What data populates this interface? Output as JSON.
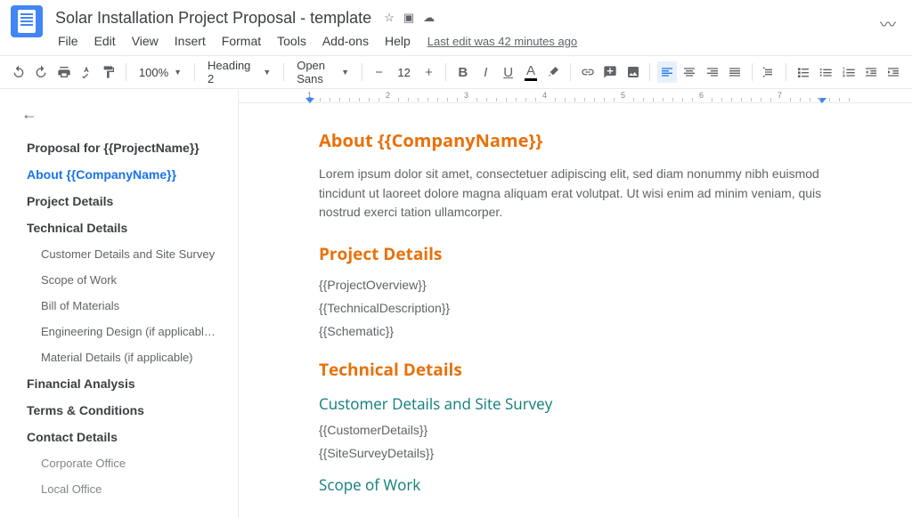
{
  "header": {
    "doc_title": "Solar Installation Project Proposal - template",
    "last_edit": "Last edit was 42 minutes ago"
  },
  "menu": {
    "file": "File",
    "edit": "Edit",
    "view": "View",
    "insert": "Insert",
    "format": "Format",
    "tools": "Tools",
    "addons": "Add-ons",
    "help": "Help"
  },
  "toolbar": {
    "zoom": "100%",
    "style": "Heading 2",
    "font": "Open Sans",
    "size": "12"
  },
  "outline": {
    "items": [
      {
        "label": "Proposal for {{ProjectName}}",
        "level": "h1"
      },
      {
        "label": "About {{CompanyName}}",
        "level": "h1",
        "active": true
      },
      {
        "label": "Project Details",
        "level": "h1"
      },
      {
        "label": "Technical Details",
        "level": "h1"
      },
      {
        "label": "Customer Details and Site Survey",
        "level": "h2"
      },
      {
        "label": "Scope of Work",
        "level": "h2"
      },
      {
        "label": "Bill of Materials",
        "level": "h2"
      },
      {
        "label": "Engineering Design (if applicabl…",
        "level": "h2"
      },
      {
        "label": "Material Details (if applicable)",
        "level": "h2"
      },
      {
        "label": "Financial Analysis",
        "level": "h1"
      },
      {
        "label": "Terms & Conditions",
        "level": "h1"
      },
      {
        "label": "Contact Details",
        "level": "h1"
      },
      {
        "label": "Corporate Office",
        "level": "h3"
      },
      {
        "label": "Local Office",
        "level": "h3"
      }
    ]
  },
  "doc": {
    "about_heading": "About {{CompanyName}}",
    "about_body": "Lorem ipsum dolor sit amet, consectetuer adipiscing elit, sed diam nonummy nibh euismod tincidunt ut laoreet dolore magna aliquam erat volutpat. Ut wisi enim ad minim veniam, quis nostrud exerci tation ullamcorper.",
    "project_heading": "Project Details",
    "project_lines": [
      "{{ProjectOverview}}",
      "{{TechnicalDescription}}",
      "{{Schematic}}"
    ],
    "tech_heading": "Technical Details",
    "cust_heading": "Customer Details and Site Survey",
    "cust_lines": [
      "{{CustomerDetails}}",
      "{{SiteSurveyDetails}}"
    ],
    "scope_heading": "Scope of Work"
  },
  "ruler": {
    "ticks": [
      "1",
      "2",
      "3",
      "4",
      "5",
      "6",
      "7"
    ]
  }
}
